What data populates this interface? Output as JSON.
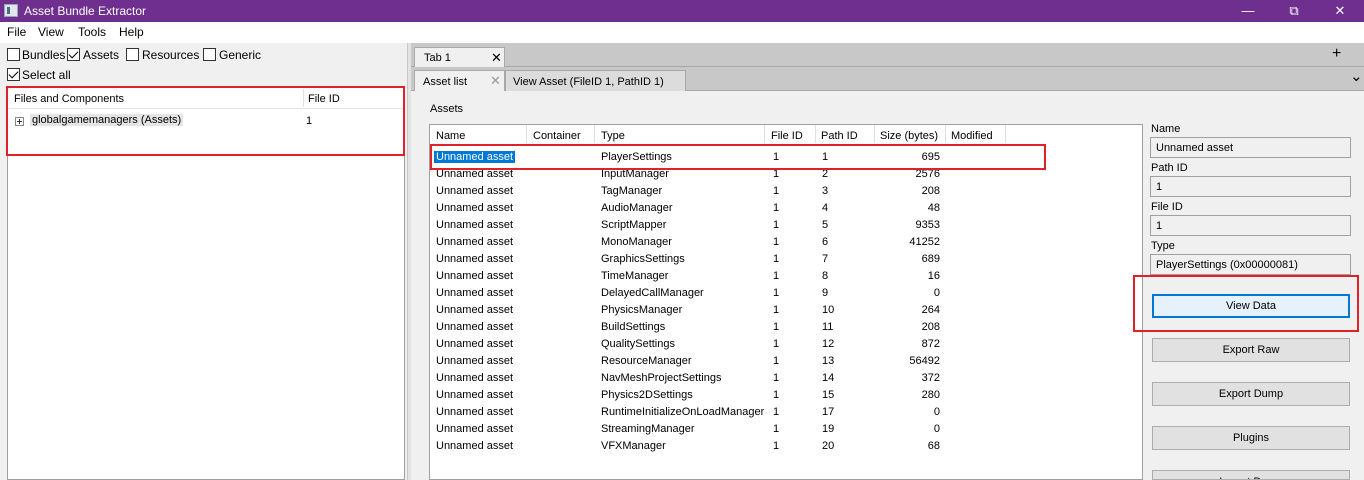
{
  "window": {
    "title": "Asset Bundle Extractor",
    "minimize": "—",
    "restore": "⧉",
    "close": "✕"
  },
  "menu": [
    "File",
    "View",
    "Tools",
    "Help"
  ],
  "filters": {
    "bundles": {
      "label": "Bundles",
      "checked": false
    },
    "assets": {
      "label": "Assets",
      "checked": true
    },
    "resources": {
      "label": "Resources",
      "checked": false
    },
    "generic": {
      "label": "Generic",
      "checked": false
    },
    "select_all": {
      "label": "Select all",
      "checked": true
    }
  },
  "tree": {
    "headers": [
      "Files and Components",
      "File ID"
    ],
    "rows": [
      {
        "name": "globalgamemanagers (Assets)",
        "file_id": "1"
      }
    ]
  },
  "tabs": {
    "main": [
      {
        "label": "Tab 1",
        "close": "✕"
      }
    ],
    "add": "+",
    "chevron_down": "⌄",
    "sub": [
      {
        "label": "Asset list",
        "close": "✕"
      },
      {
        "label": "View Asset (FileID 1, PathID 1)"
      }
    ]
  },
  "assets_section_label": "Assets",
  "asset_table": {
    "columns": [
      "Name",
      "Container",
      "Type",
      "File ID",
      "Path ID",
      "Size (bytes)",
      "Modified"
    ],
    "rows": [
      {
        "name": "Unnamed asset",
        "container": "",
        "type": "PlayerSettings",
        "file_id": "1",
        "path_id": "1",
        "size": "695",
        "modified": ""
      },
      {
        "name": "Unnamed asset",
        "container": "",
        "type": "InputManager",
        "file_id": "1",
        "path_id": "2",
        "size": "2576",
        "modified": ""
      },
      {
        "name": "Unnamed asset",
        "container": "",
        "type": "TagManager",
        "file_id": "1",
        "path_id": "3",
        "size": "208",
        "modified": ""
      },
      {
        "name": "Unnamed asset",
        "container": "",
        "type": "AudioManager",
        "file_id": "1",
        "path_id": "4",
        "size": "48",
        "modified": ""
      },
      {
        "name": "Unnamed asset",
        "container": "",
        "type": "ScriptMapper",
        "file_id": "1",
        "path_id": "5",
        "size": "9353",
        "modified": ""
      },
      {
        "name": "Unnamed asset",
        "container": "",
        "type": "MonoManager",
        "file_id": "1",
        "path_id": "6",
        "size": "41252",
        "modified": ""
      },
      {
        "name": "Unnamed asset",
        "container": "",
        "type": "GraphicsSettings",
        "file_id": "1",
        "path_id": "7",
        "size": "689",
        "modified": ""
      },
      {
        "name": "Unnamed asset",
        "container": "",
        "type": "TimeManager",
        "file_id": "1",
        "path_id": "8",
        "size": "16",
        "modified": ""
      },
      {
        "name": "Unnamed asset",
        "container": "",
        "type": "DelayedCallManager",
        "file_id": "1",
        "path_id": "9",
        "size": "0",
        "modified": ""
      },
      {
        "name": "Unnamed asset",
        "container": "",
        "type": "PhysicsManager",
        "file_id": "1",
        "path_id": "10",
        "size": "264",
        "modified": ""
      },
      {
        "name": "Unnamed asset",
        "container": "",
        "type": "BuildSettings",
        "file_id": "1",
        "path_id": "11",
        "size": "208",
        "modified": ""
      },
      {
        "name": "Unnamed asset",
        "container": "",
        "type": "QualitySettings",
        "file_id": "1",
        "path_id": "12",
        "size": "872",
        "modified": ""
      },
      {
        "name": "Unnamed asset",
        "container": "",
        "type": "ResourceManager",
        "file_id": "1",
        "path_id": "13",
        "size": "56492",
        "modified": ""
      },
      {
        "name": "Unnamed asset",
        "container": "",
        "type": "NavMeshProjectSettings",
        "file_id": "1",
        "path_id": "14",
        "size": "372",
        "modified": ""
      },
      {
        "name": "Unnamed asset",
        "container": "",
        "type": "Physics2DSettings",
        "file_id": "1",
        "path_id": "15",
        "size": "280",
        "modified": ""
      },
      {
        "name": "Unnamed asset",
        "container": "",
        "type": "RuntimeInitializeOnLoadManager",
        "file_id": "1",
        "path_id": "17",
        "size": "0",
        "modified": ""
      },
      {
        "name": "Unnamed asset",
        "container": "",
        "type": "StreamingManager",
        "file_id": "1",
        "path_id": "19",
        "size": "0",
        "modified": ""
      },
      {
        "name": "Unnamed asset",
        "container": "",
        "type": "VFXManager",
        "file_id": "1",
        "path_id": "20",
        "size": "68",
        "modified": ""
      }
    ]
  },
  "details": {
    "name_label": "Name",
    "name_value": "Unnamed asset",
    "path_id_label": "Path ID",
    "path_id_value": "1",
    "file_id_label": "File ID",
    "file_id_value": "1",
    "type_label": "Type",
    "type_value": "PlayerSettings (0x00000081)"
  },
  "buttons": {
    "view_data": "View Data",
    "export_raw": "Export Raw",
    "export_dump": "Export Dump",
    "plugins": "Plugins",
    "import_dump": "Import Dump"
  },
  "colors": {
    "titlebar": "#6f2f8f",
    "selection": "#0078d7",
    "highlight": "#e0202a"
  }
}
